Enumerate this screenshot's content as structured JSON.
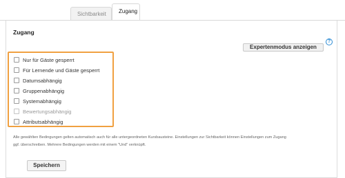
{
  "tabs": [
    {
      "label": "Sichtbarkeit",
      "active": false
    },
    {
      "label": "Zugang",
      "active": true
    }
  ],
  "section": {
    "title": "Zugang"
  },
  "expert_button": {
    "label": "Expertenmodus anzeigen"
  },
  "help": {
    "icon": "help-circle-icon",
    "glyph": "?"
  },
  "conditions": [
    {
      "label": "Nur für Gäste gesperrt",
      "checked": false,
      "enabled": true
    },
    {
      "label": "Für Lernende und Gäste gesperrt",
      "checked": false,
      "enabled": true
    },
    {
      "label": "Datumsabhängig",
      "checked": false,
      "enabled": true
    },
    {
      "label": "Gruppenabhängig",
      "checked": false,
      "enabled": true
    },
    {
      "label": "Systemabhängig",
      "checked": false,
      "enabled": true
    },
    {
      "label": "Bewertungsabhängig",
      "checked": false,
      "enabled": false
    },
    {
      "label": "Attributsabhängig",
      "checked": false,
      "enabled": true
    }
  ],
  "info_text": {
    "line1": "Alle gewählten Bedingungen gelten automatisch auch für alle untergeordneten Kursbausteine. Einstellungen zur Sichtbarkeit können Einstellungen zum Zugang",
    "line2": "ggf. überschreiben. Mehrere Bedingungen werden mit einem \"Und\" verknüpft."
  },
  "save_button": {
    "label": "Speichern"
  },
  "colors": {
    "highlight": "#f0a040",
    "help": "#2a8ad4",
    "border": "#d8d8d8"
  }
}
